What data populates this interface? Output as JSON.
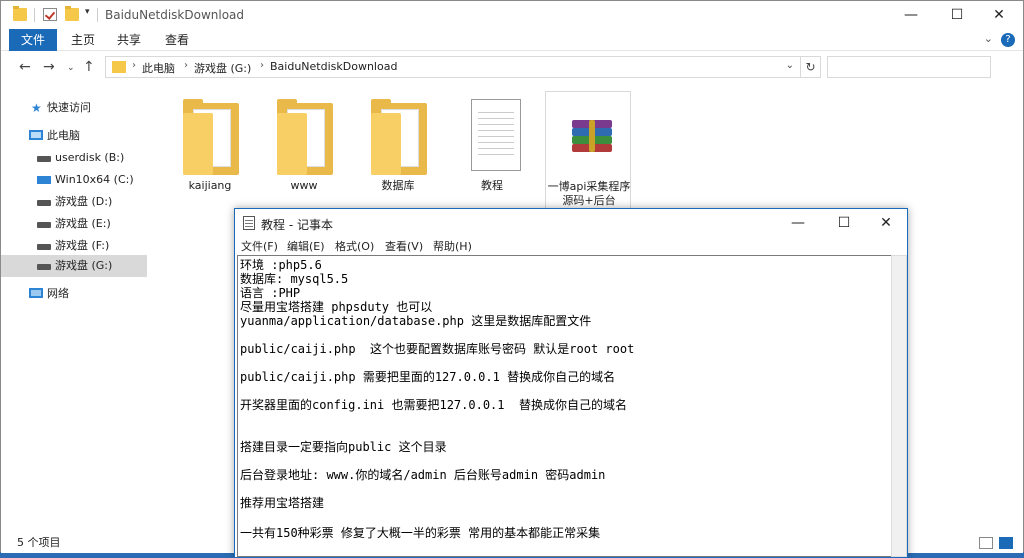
{
  "explorer": {
    "title": "BaiduNetdiskDownload",
    "ribbon_tabs": [
      "文件",
      "主页",
      "共享",
      "查看"
    ],
    "address": {
      "crumbs": [
        "此电脑",
        "游戏盘 (G:)",
        "BaiduNetdiskDownload"
      ]
    },
    "search_placeholder": "",
    "nav": {
      "quick_access": "快速访问",
      "this_pc": "此电脑",
      "drives": [
        "userdisk (B:)",
        "Win10x64 (C:)",
        "游戏盘 (D:)",
        "游戏盘 (E:)",
        "游戏盘 (F:)",
        "游戏盘 (G:)"
      ],
      "selected_drive": "游戏盘 (G:)",
      "network": "网络"
    },
    "items": [
      {
        "name": "kaijiang",
        "type": "folder"
      },
      {
        "name": "www",
        "type": "folder"
      },
      {
        "name": "数据库",
        "type": "folder"
      },
      {
        "name": "教程",
        "type": "text-file"
      },
      {
        "name": "一博api采集程序源码+后台",
        "type": "rar-archive"
      }
    ],
    "status_count": "5 个项目"
  },
  "notepad": {
    "title": "教程 - 记事本",
    "menus": [
      "文件(F)",
      "编辑(E)",
      "格式(O)",
      "查看(V)",
      "帮助(H)"
    ],
    "lines": [
      "环境 :php5.6",
      "数据库: mysql5.5",
      "语言 :PHP",
      "尽量用宝塔搭建 phpsduty 也可以",
      "yuanma/application/database.php 这里是数据库配置文件",
      "public/caiji.php  这个也要配置数据库账号密码 默认是root root",
      "public/caiji.php 需要把里面的127.0.0.1 替换成你自己的域名",
      "开奖器里面的config.ini 也需要把127.0.0.1  替换成你自己的域名",
      "搭建目录一定要指向public 这个目录",
      "后台登录地址: www.你的域名/admin 后台账号admin 密码admin",
      "推荐用宝塔搭建",
      "一共有150种彩票 修复了大概一半的彩票 常用的基本都能正常采集"
    ]
  },
  "colors": {
    "accent": "#1a6ab8",
    "folder": "#f6c84a",
    "desktop": "#2b6cb4"
  }
}
